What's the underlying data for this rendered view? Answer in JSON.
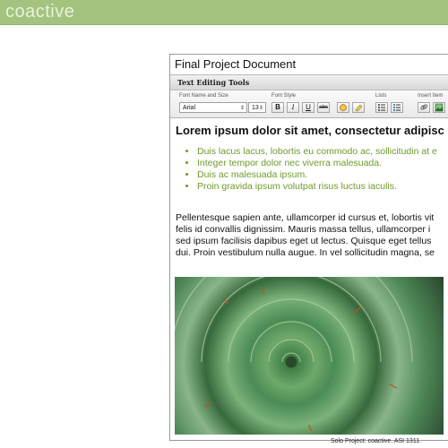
{
  "brand": {
    "name": "coactive"
  },
  "document": {
    "title": "Final Project Document",
    "toolbar": {
      "title": "Text Editing Tools",
      "groups": {
        "font_name_label": "Font Name and Size",
        "font_style_label": "Font Style",
        "lists_label": "Lists",
        "insert_label": "Insert Item"
      },
      "font_name": "Arial",
      "font_size": "13",
      "buttons": {
        "bold": "B",
        "italic": "I",
        "underline": "U",
        "strike": "abc"
      }
    },
    "heading": "Lorem ipsum dolor sit amet, consectetur adipisc",
    "bullets": [
      "Duis lacus lacus, lobortis eu commodo ac, sollicitudin at e",
      "Integer tempor dolor nec viverra malesuada.",
      "Duis ac malesuada ipsum.",
      "Proin gravida ipsum volutpat risus luctus iaculis."
    ],
    "paragraph_lines": [
      "Pellentesque sapien ante, ullamcorper id cursus et, lobortis vit",
      "felis id convallis dignissim. Mauris massa tellus, ullamcorper i",
      "sed ipsum facilisis dapibus eget ut lectus. Quisque eget tellus",
      "dui. Proin vestibulum nulla augue. In vel sollicitudin magna, se"
    ]
  },
  "footer": {
    "caption": "Solo Project: coactive. ASI 1311."
  }
}
